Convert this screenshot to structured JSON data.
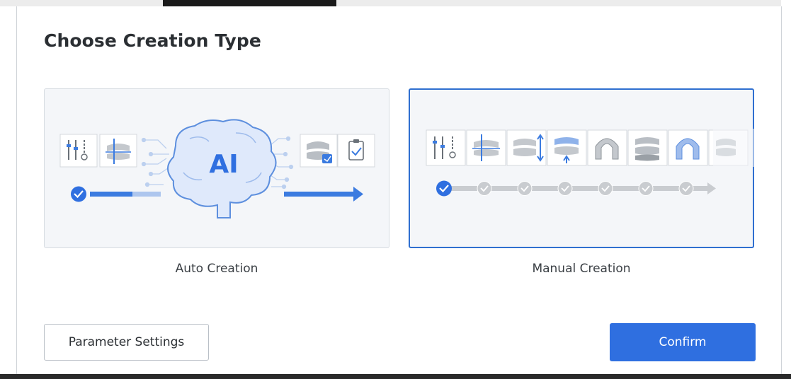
{
  "dialog": {
    "title": "Choose Creation Type"
  },
  "options": {
    "auto": {
      "label": "Auto Creation",
      "badge": "AI"
    },
    "manual": {
      "label": "Manual Creation",
      "selected": true
    }
  },
  "footer": {
    "parameter_settings_label": "Parameter Settings",
    "confirm_label": "Confirm"
  },
  "colors": {
    "accent": "#2f6fe0",
    "selected_border": "#2f6fd0",
    "card_bg": "#f4f6f9",
    "step_inactive": "#c9ccd0",
    "brain_fill": "#dfe9fb"
  },
  "icons": {
    "auto_steps": [
      "tools-icon",
      "cut-plane-icon",
      "ai-brain-icon",
      "aligner-icon",
      "checklist-icon"
    ],
    "manual_steps": [
      "tools-icon",
      "cut-plane-icon",
      "adjust-icon",
      "raise-icon",
      "arch-icon",
      "stack-icon",
      "arch-trim-icon",
      "partial-icon"
    ]
  }
}
